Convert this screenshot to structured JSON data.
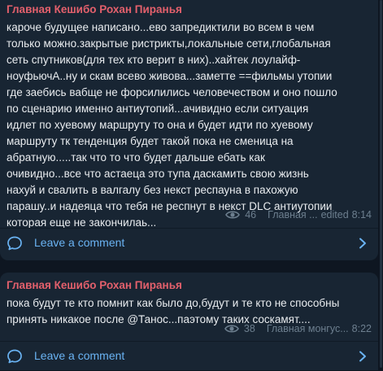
{
  "posts": [
    {
      "author": "Главная Кешибо Рохан Пиранья",
      "lines": [
        "кароче будущее написано...ево запредиктили во всем в чем",
        "только можно.закрытые ристрикты,локальные сети,глобальная",
        "сеть спутников(для тех кто верит в них)..хайтек лоулайф-",
        "ноуфьючА..ну и скам всево живова...заметте ==фильмы утопии",
        "где заебись вабще не форсилились человечеством и оно пошло",
        "по сценарию именно антиутопий...ачивидно если ситуация",
        "идлет по хуевому маршруту то она и будет идти по хуевому",
        "маршруту тк тенденция будет такой пока не сменица на",
        "абратную.....так что то что будет дальше ебать как",
        "очивидно...все что астаеца это тупа даскамить свою жизнь",
        "нахуй и свалить в  валгалу без некст респауна в пахожую",
        "парашу..и надеяца что тебя не респнут в некст DLC антиутопии",
        "которая еще не закончилаь..."
      ],
      "views": "46",
      "signature": "Главная ...",
      "status": "edited",
      "time": "8:14",
      "comment_label": "Leave a comment"
    },
    {
      "author": "Главная Кешибо Рохан Пиранья",
      "lines": [
        "пока будут те кто помнит как было до,будут и те кто не способны",
        "принять никакое после @Танос...паэтому таких соскамят...."
      ],
      "views": "38",
      "signature": "Главная монгус...",
      "status": "",
      "time": "8:22",
      "comment_label": "Leave a comment"
    }
  ],
  "colors": {
    "background": "#0e1621",
    "bubble": "#182533",
    "author": "#e3606c",
    "link": "#6ab3f3",
    "meta": "#6d7f8f"
  },
  "icons": [
    "eye-icon",
    "comment-icon",
    "chevron-right-icon"
  ]
}
